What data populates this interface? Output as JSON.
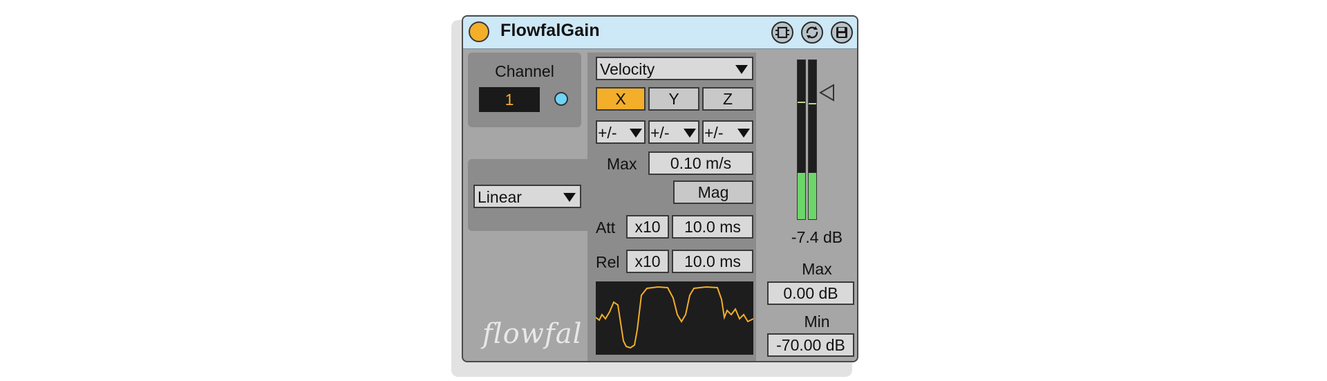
{
  "device": {
    "title": "FlowfalGain",
    "accent_color": "#f3ae2a",
    "titlebar_color": "#cde8f6",
    "icons": [
      "power-icon",
      "hotswap-icon",
      "map-icon",
      "save-icon"
    ]
  },
  "channel": {
    "label": "Channel",
    "value": "1",
    "led_color": "#6fd4f5"
  },
  "curve": {
    "selected": "Linear"
  },
  "source": {
    "selected": "Velocity"
  },
  "axes": {
    "buttons": [
      {
        "label": "X",
        "active": true
      },
      {
        "label": "Y",
        "active": false
      },
      {
        "label": "Z",
        "active": false
      }
    ],
    "polarity": [
      "+/-",
      "+/-",
      "+/-"
    ]
  },
  "scaling": {
    "max_label": "Max",
    "max_value": "0.10 m/s",
    "mag_label": "Mag"
  },
  "envelope": {
    "att_label": "Att",
    "att_mult": "x10",
    "att_value": "10.0 ms",
    "rel_label": "Rel",
    "rel_mult": "x10",
    "rel_value": "10.0 ms"
  },
  "meter": {
    "readout": "-7.4 dB",
    "left_level": 0.29,
    "right_level": 0.29,
    "max_label": "Max",
    "max_value": "0.00 dB",
    "min_label": "Min",
    "min_value": "-70.00 dB",
    "fill_color": "#6dd66a"
  },
  "brand": {
    "logo_text": "flowfal"
  }
}
